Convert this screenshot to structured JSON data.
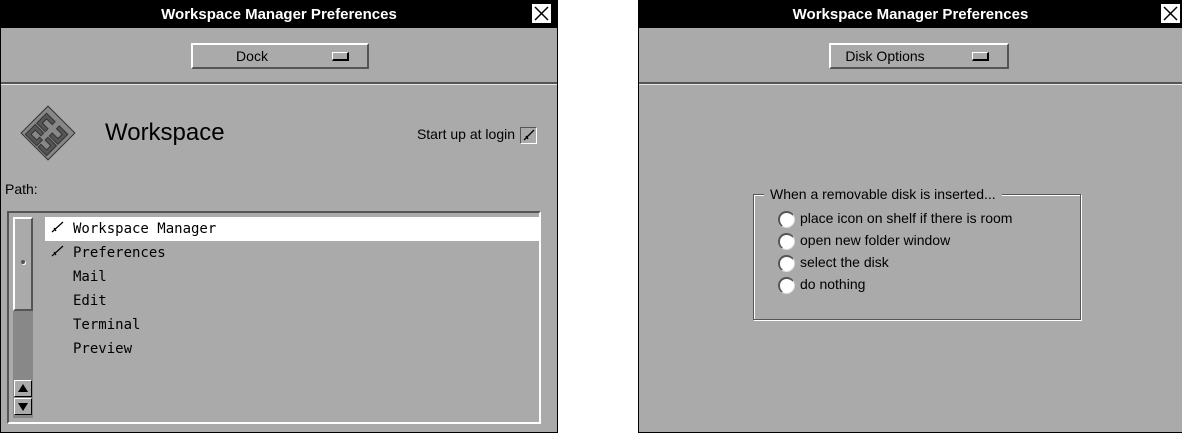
{
  "left_window": {
    "title": "Workspace Manager Preferences",
    "close_icon": "close-icon",
    "popup_value": "Dock",
    "header_title": "Workspace",
    "startup_label": "Start up at login",
    "startup_checked": true,
    "path_label": "Path:",
    "path_items": [
      {
        "label": "Workspace Manager",
        "checked": true,
        "selected": true
      },
      {
        "label": "Preferences",
        "checked": true,
        "selected": false
      },
      {
        "label": "Mail",
        "checked": false,
        "selected": false
      },
      {
        "label": "Edit",
        "checked": false,
        "selected": false
      },
      {
        "label": "Terminal",
        "checked": false,
        "selected": false
      },
      {
        "label": "Preview",
        "checked": false,
        "selected": false
      }
    ]
  },
  "right_window": {
    "title": "Workspace Manager Preferences",
    "close_icon": "close-icon",
    "popup_value": "Disk Options",
    "group_title": "When a removable disk is inserted...",
    "options": [
      "place icon on shelf if there is room",
      "open new folder window",
      "select the disk",
      "do nothing"
    ]
  },
  "colors": {
    "window_bg": "#aaaaaa",
    "titlebar_bg": "#000000",
    "titlebar_text": "#ffffff",
    "selection_bg": "#ffffff"
  }
}
